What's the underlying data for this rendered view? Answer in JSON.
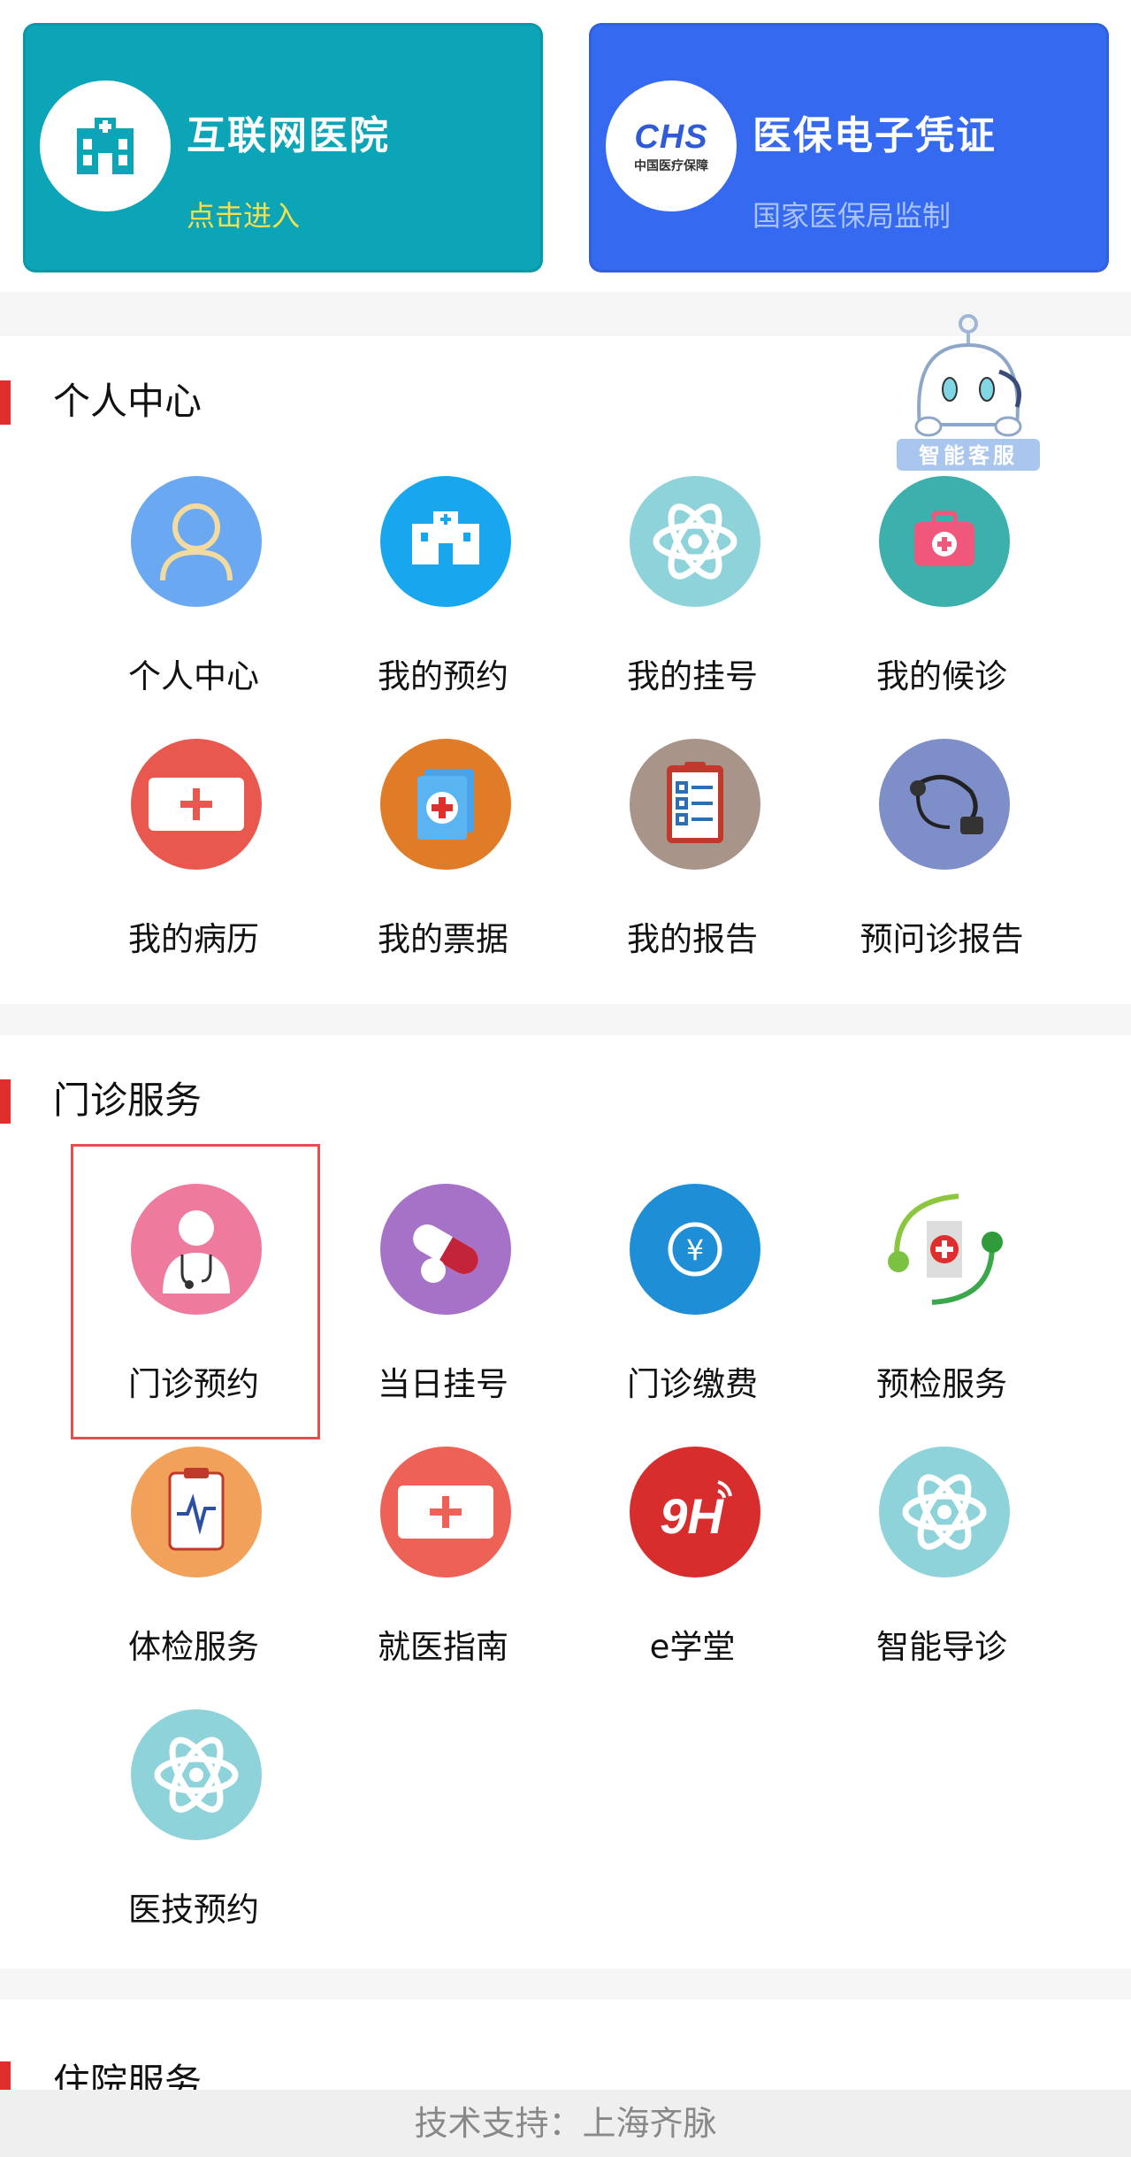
{
  "banners": {
    "hospital": {
      "title": "互联网医院",
      "subtitle": "点击进入"
    },
    "insurance": {
      "title": "医保电子凭证",
      "subtitle": "国家医保局监制",
      "logo_text": "CHS",
      "logo_sub": "中国医疗保障"
    }
  },
  "assistant": {
    "label": "智能客服",
    "icon": "robot-mascot-icon"
  },
  "personal": {
    "title": "个人中心",
    "items": [
      {
        "label": "个人中心",
        "icon": "user-icon",
        "color": "#6aa9f2"
      },
      {
        "label": "我的预约",
        "icon": "hospital-building-icon",
        "color": "#18a7ef"
      },
      {
        "label": "我的挂号",
        "icon": "atom-icon",
        "color": "#8fd3da"
      },
      {
        "label": "我的候诊",
        "icon": "first-aid-kit-icon",
        "color": "#3cb0ac"
      },
      {
        "label": "我的病历",
        "icon": "medical-record-icon",
        "color": "#e8584f"
      },
      {
        "label": "我的票据",
        "icon": "receipt-icon",
        "color": "#e07b27"
      },
      {
        "label": "我的报告",
        "icon": "clipboard-report-icon",
        "color": "#a89488"
      },
      {
        "label": "预问诊报告",
        "icon": "stethoscope-icon",
        "color": "#7d8ec9"
      }
    ]
  },
  "outpatient": {
    "title": "门诊服务",
    "items": [
      {
        "label": "门诊预约",
        "icon": "doctor-icon",
        "color": "#ee7a9d"
      },
      {
        "label": "当日挂号",
        "icon": "pill-capsule-icon",
        "color": "#a572c8"
      },
      {
        "label": "门诊缴费",
        "icon": "yuan-coin-icon",
        "color": "#1e8fd6"
      },
      {
        "label": "预检服务",
        "icon": "hospital-emblem-icon",
        "color": "#ffffff"
      },
      {
        "label": "体检服务",
        "icon": "ecg-clipboard-icon",
        "color": "#f2a15a"
      },
      {
        "label": "就医指南",
        "icon": "medical-guide-icon",
        "color": "#ee6157"
      },
      {
        "label": "e学堂",
        "icon": "9h-logo-icon",
        "color": "#d72d2d"
      },
      {
        "label": "智能导诊",
        "icon": "atom-icon",
        "color": "#8fd3da"
      },
      {
        "label": "医技预约",
        "icon": "atom-icon",
        "color": "#8fd3da"
      }
    ]
  },
  "inpatient": {
    "title": "住院服务"
  },
  "footer": {
    "text": "技术支持：上海齐脉"
  }
}
